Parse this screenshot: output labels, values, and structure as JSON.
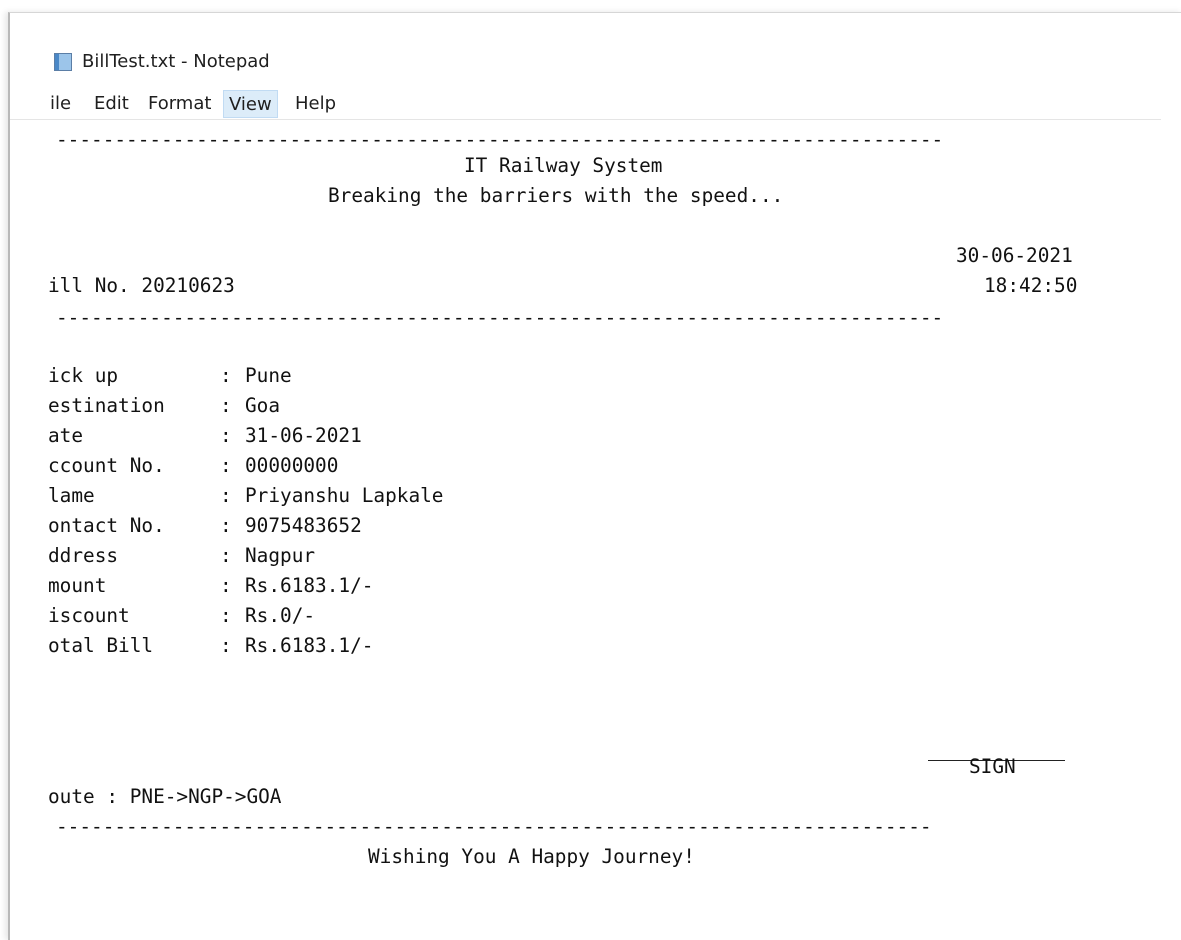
{
  "window": {
    "title": "BillTest.txt - Notepad",
    "app_icon": "notepad-icon"
  },
  "menu": {
    "file": "ile",
    "edit": "Edit",
    "format": "Format",
    "view": "View",
    "help": "Help",
    "active_item": "View",
    "active_color": "#dcecf9"
  },
  "document": {
    "separator_top": "----------------------------------------------------------------------------",
    "company_name": "IT Railway System",
    "tagline": "Breaking the barriers with the speed...",
    "date": "30-06-2021",
    "bill_number": "ill No. 20210623",
    "time": "18:42:50",
    "separator_mid": "----------------------------------------------------------------------------",
    "fields": [
      {
        "label": "ick up",
        "sep": ":",
        "value": "Pune"
      },
      {
        "label": "estination",
        "sep": ":",
        "value": "Goa"
      },
      {
        "label": "ate",
        "sep": ":",
        "value": "31-06-2021"
      },
      {
        "label": "ccount No.",
        "sep": ":",
        "value": "00000000"
      },
      {
        "label": "lame",
        "sep": ":",
        "value": "Priyanshu Lapkale"
      },
      {
        "label": "ontact No.",
        "sep": ":",
        "value": "9075483652"
      },
      {
        "label": "ddress",
        "sep": ":",
        "value": "Nagpur"
      },
      {
        "label": "mount",
        "sep": ":",
        "value": "Rs.6183.1/-"
      },
      {
        "label": "iscount",
        "sep": ":",
        "value": "Rs.0/-"
      },
      {
        "label": "otal Bill",
        "sep": ":",
        "value": "Rs.6183.1/-"
      }
    ],
    "sign_label": "SIGN",
    "route": "oute : PNE->NGP->GOA",
    "separator_bottom": "---------------------------------------------------------------------------",
    "footer": "Wishing You A Happy Journey!"
  }
}
